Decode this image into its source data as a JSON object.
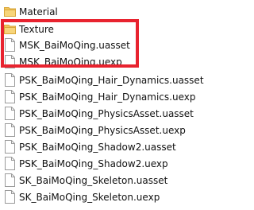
{
  "files": [
    {
      "name": "Material",
      "type": "folder",
      "icon": "folder-icon"
    },
    {
      "name": "Texture",
      "type": "folder",
      "icon": "folder-icon"
    },
    {
      "name": "MSK_BaiMoQing.uasset",
      "type": "file",
      "icon": "file-icon"
    },
    {
      "name": "MSK_BaiMoQing.uexp",
      "type": "file",
      "icon": "file-icon"
    },
    {
      "name": "PSK_BaiMoQing_Hair_Dynamics.uasset",
      "type": "file",
      "icon": "file-icon"
    },
    {
      "name": "PSK_BaiMoQing_Hair_Dynamics.uexp",
      "type": "file",
      "icon": "file-icon"
    },
    {
      "name": "PSK_BaiMoQing_PhysicsAsset.uasset",
      "type": "file",
      "icon": "file-icon"
    },
    {
      "name": "PSK_BaiMoQing_PhysicsAsset.uexp",
      "type": "file",
      "icon": "file-icon"
    },
    {
      "name": "PSK_BaiMoQing_Shadow2.uasset",
      "type": "file",
      "icon": "file-icon"
    },
    {
      "name": "PSK_BaiMoQing_Shadow2.uexp",
      "type": "file",
      "icon": "file-icon"
    },
    {
      "name": "SK_BaiMoQing_Skeleton.uasset",
      "type": "file",
      "icon": "file-icon"
    },
    {
      "name": "SK_BaiMoQing_Skeleton.uexp",
      "type": "file",
      "icon": "file-icon"
    }
  ],
  "colors": {
    "highlight": "#e8232f",
    "folder": "#f2c55c",
    "file_outline": "#9a9a9a"
  }
}
